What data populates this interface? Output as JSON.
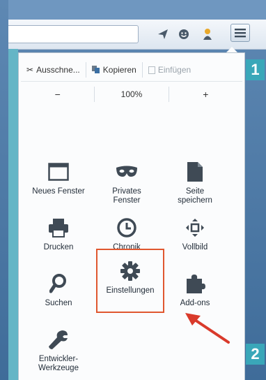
{
  "toolbar": {
    "icons": [
      "send-icon",
      "smiley-icon",
      "user-icon",
      "hamburger-menu-icon"
    ]
  },
  "edit_row": {
    "cut_label": "Ausschne...",
    "copy_label": "Kopieren",
    "paste_label": "Einfügen"
  },
  "zoom": {
    "minus": "−",
    "level": "100%",
    "plus": "+"
  },
  "tiles": [
    {
      "label": "Neues Fenster",
      "icon": "window-icon"
    },
    {
      "label": "Privates Fenster",
      "icon": "mask-icon"
    },
    {
      "label": "Seite speichern",
      "icon": "page-icon"
    },
    {
      "label": "Drucken",
      "icon": "printer-icon"
    },
    {
      "label": "Chronik",
      "icon": "clock-icon"
    },
    {
      "label": "Vollbild",
      "icon": "fullscreen-icon"
    },
    {
      "label": "Suchen",
      "icon": "magnifier-icon"
    },
    {
      "label": "Einstellungen",
      "icon": "gear-icon"
    },
    {
      "label": "Add-ons",
      "icon": "puzzle-icon"
    },
    {
      "label": "Entwickler-Werkzeuge",
      "icon": "wrench-icon"
    }
  ],
  "callouts": {
    "first": "1",
    "second": "2"
  },
  "colors": {
    "accent_highlight": "#e0572f",
    "callout_bg": "#3aa7b9",
    "icon_color": "#3f4a55"
  }
}
